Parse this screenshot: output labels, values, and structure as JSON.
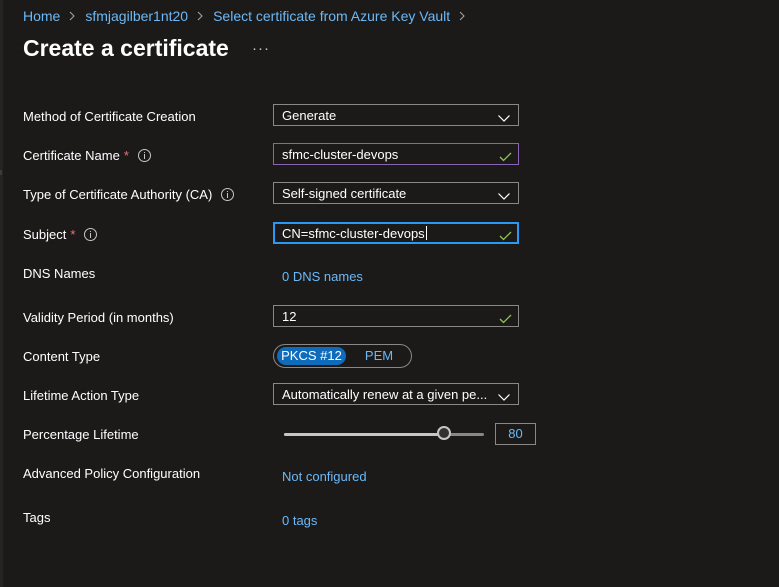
{
  "breadcrumb": [
    {
      "label": "Home"
    },
    {
      "label": "sfmjagilber1nt20"
    },
    {
      "label": "Select certificate from Azure Key Vault"
    }
  ],
  "page": {
    "title": "Create a certificate",
    "more": "···"
  },
  "form": {
    "method": {
      "label": "Method of Certificate Creation",
      "value": "Generate"
    },
    "cert_name": {
      "label": "Certificate Name",
      "required_mark": "*",
      "value": "sfmc-cluster-devops"
    },
    "ca_type": {
      "label": "Type of Certificate Authority (CA)",
      "value": "Self-signed certificate"
    },
    "subject": {
      "label": "Subject",
      "required_mark": "*",
      "value": "CN=sfmc-cluster-devops"
    },
    "dns_names": {
      "label": "DNS Names",
      "link": "0 DNS names"
    },
    "validity": {
      "label": "Validity Period (in months)",
      "value": "12"
    },
    "content_type": {
      "label": "Content Type",
      "options": [
        "PKCS #12",
        "PEM"
      ],
      "selected": "PKCS #12"
    },
    "lifetime_action": {
      "label": "Lifetime Action Type",
      "value": "Automatically renew at a given pe..."
    },
    "percentage_lifetime": {
      "label": "Percentage Lifetime",
      "value": "80",
      "fraction": 0.8
    },
    "advanced_policy": {
      "label": "Advanced Policy Configuration",
      "link": "Not configured"
    },
    "tags": {
      "label": "Tags",
      "link": "0 tags"
    }
  },
  "colors": {
    "background": "#1b1a19",
    "link": "#6cb8f6",
    "accent": "#0f6cbd",
    "focus_border": "#2899f5",
    "valid_check": "#92c353",
    "required": "#f1707b"
  }
}
